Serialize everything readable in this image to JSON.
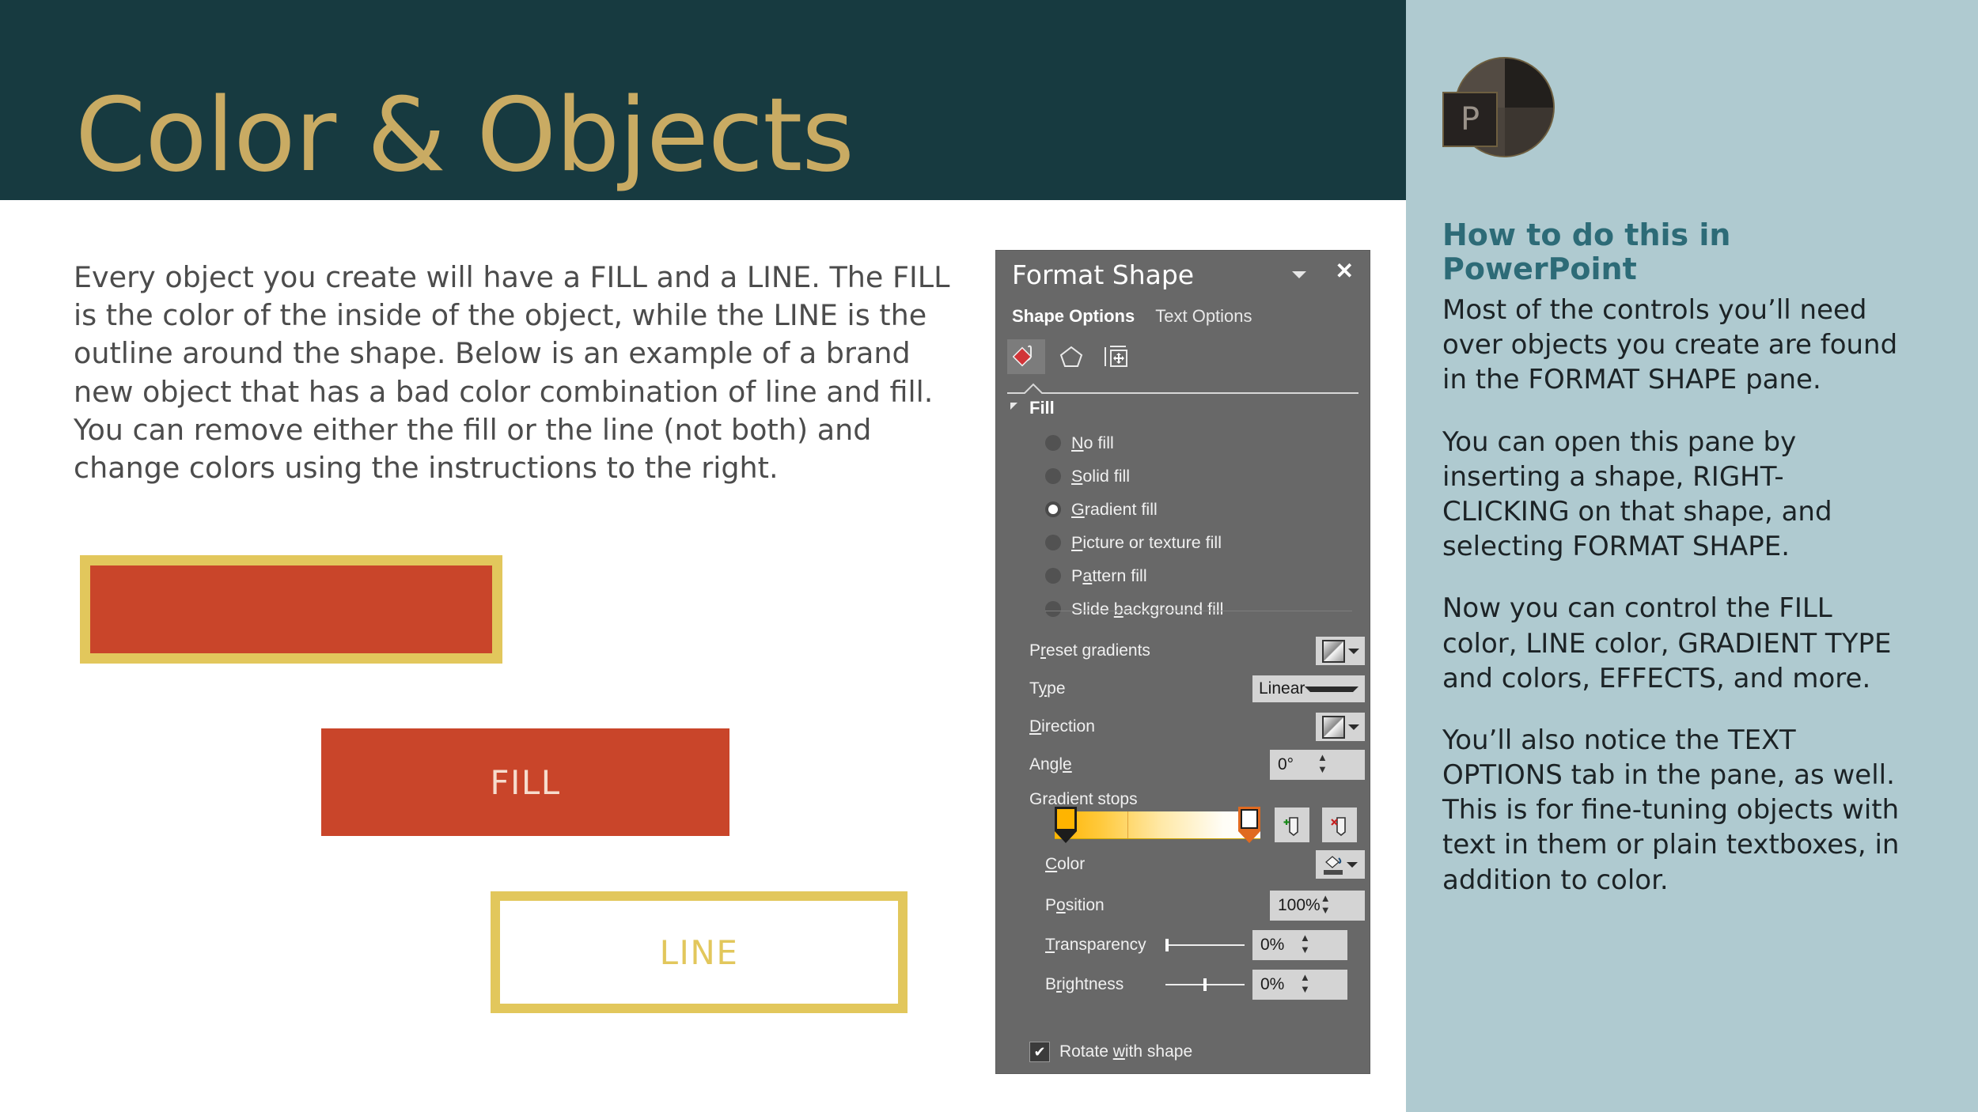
{
  "slide": {
    "title": "Color & Objects",
    "body_text": "Every object you create will have a FILL and a LINE. The FILL is the color of the inside of the object, while the LINE is the outline around the shape. Below is an example of a brand new object that has a bad color combination of line and fill. You can remove either the fill or the line (not both) and change colors using the instructions to the right.",
    "colors": {
      "title_band": "#173A40",
      "title_text": "#C9AB63",
      "shape_fill": "#C9452A",
      "shape_line": "#E2C75C",
      "sidebar_bg": "#AFCAD0",
      "sidebar_heading": "#2D6B77",
      "pane_bg": "#686868"
    },
    "examples": {
      "bad_combo_label": "",
      "fill_label": "FILL",
      "line_label": "LINE"
    }
  },
  "format_shape_pane": {
    "title": "Format Shape",
    "caret_icon": "chevron-down-icon",
    "close_label": "✕",
    "tabs": [
      {
        "label": "Shape Options",
        "active": true
      },
      {
        "label": "Text Options",
        "active": false
      }
    ],
    "icon_tabs": [
      {
        "name": "fill-and-line-icon",
        "active": true
      },
      {
        "name": "effects-pentagon-icon",
        "active": false
      },
      {
        "name": "size-and-properties-icon",
        "active": false
      }
    ],
    "section": {
      "label": "Fill",
      "expanded": true,
      "triangle_icon": "triangle-collapse-icon"
    },
    "fill_options": [
      {
        "label": "No fill",
        "mnemonic": "N",
        "selected": false
      },
      {
        "label": "Solid fill",
        "mnemonic": "S",
        "selected": false
      },
      {
        "label": "Gradient fill",
        "mnemonic": "G",
        "selected": true
      },
      {
        "label": "Picture or texture fill",
        "mnemonic": "P",
        "selected": false
      },
      {
        "label": "Pattern fill",
        "mnemonic": "a",
        "selected": false
      },
      {
        "label": "Slide background fill",
        "mnemonic": "b",
        "selected": false
      }
    ],
    "controls": {
      "preset_gradients": {
        "label": "Preset gradients",
        "mnemonic": "r",
        "type": "swatch-dropdown"
      },
      "type": {
        "label": "Type",
        "mnemonic": "y",
        "value": "Linear"
      },
      "direction": {
        "label": "Direction",
        "mnemonic": "D",
        "type": "swatch-dropdown"
      },
      "angle": {
        "label": "Angle",
        "mnemonic": "e",
        "value": "0°"
      },
      "gradient_stops": {
        "label": "Gradient stops"
      },
      "add_stop_icon": "add-gradient-stop-icon",
      "remove_stop_icon": "remove-gradient-stop-icon",
      "color": {
        "label": "Color",
        "mnemonic": "C",
        "type": "color-dropdown",
        "icon": "fill-bucket-icon"
      },
      "position": {
        "label": "Position",
        "mnemonic": "o",
        "value": "100%"
      },
      "transparency": {
        "label": "Transparency",
        "mnemonic": "T",
        "value": "0%",
        "slider_pct": 0
      },
      "brightness": {
        "label": "Brightness",
        "mnemonic": "i",
        "value": "0%",
        "slider_pct": 50
      },
      "rotate_with_shape": {
        "label": "Rotate with shape",
        "mnemonic": "w",
        "checked": true,
        "check_glyph": "✔"
      }
    },
    "gradient_stops_data": {
      "stops": [
        {
          "position_pct": 0,
          "color": "#FFB400",
          "selected": false
        },
        {
          "position_pct": 100,
          "color": "#FFFFFF",
          "selected": true
        }
      ],
      "bar_gradient": "linear-gradient(90deg,#FFB400 0%,#FFC93B 22%,#FFE9A8 52%,#FFFDF6 82%,#FFFFFF 100%)"
    }
  },
  "sidebar": {
    "logo": {
      "name": "powerpoint-logo",
      "letter": "P"
    },
    "heading": "How to do this in PowerPoint",
    "paragraphs": [
      "Most of the controls you’ll need over objects you create are found in the FORMAT SHAPE pane.",
      "You can open this pane by inserting a shape, RIGHT-CLICKING on that shape, and selecting FORMAT SHAPE.",
      "Now you can control the FILL color, LINE color, GRADIENT TYPE and colors, EFFECTS, and more.",
      "You’ll also notice the TEXT OPTIONS tab in the pane, as well. This is for fine-tuning objects with text in them or plain textboxes, in addition to color."
    ]
  }
}
